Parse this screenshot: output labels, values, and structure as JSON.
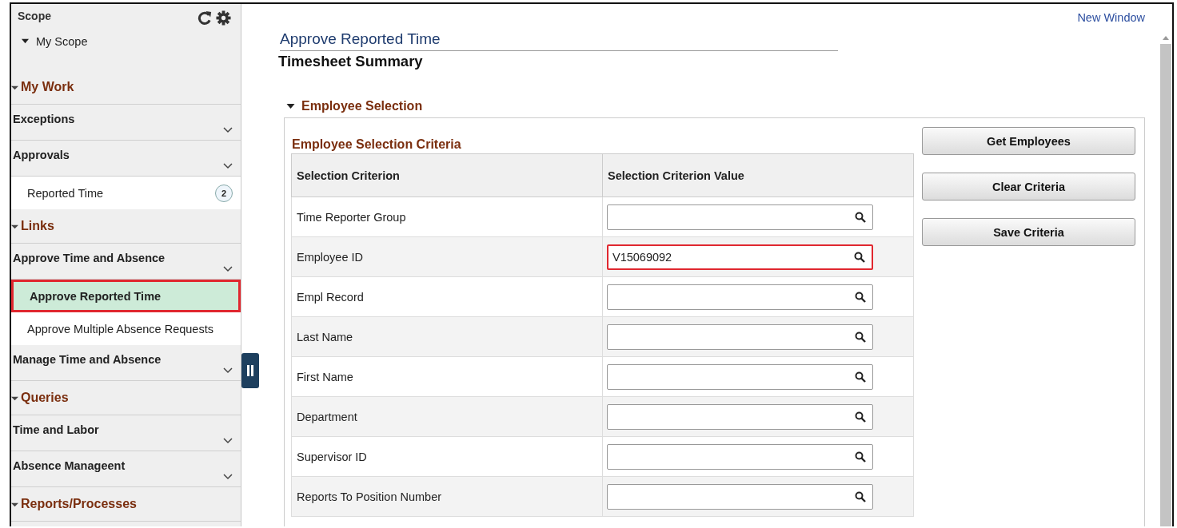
{
  "sidebar": {
    "scope": {
      "title": "Scope",
      "items": [
        {
          "label": "My Scope",
          "expanded": true
        }
      ]
    },
    "sections": [
      {
        "title": "My Work",
        "expanded": true,
        "groups": [
          {
            "label": "Exceptions"
          },
          {
            "label": "Approvals",
            "children": [
              {
                "label": "Reported Time",
                "badge": "2",
                "selected": false,
                "highlighted": false
              }
            ]
          }
        ]
      },
      {
        "title": "Links",
        "expanded": true,
        "groups": [
          {
            "label": "Approve Time and Absence",
            "children": [
              {
                "label": "Approve Reported Time",
                "selected": true,
                "highlighted": true
              },
              {
                "label": "Approve Multiple Absence Requests",
                "selected": false,
                "highlighted": false
              }
            ]
          },
          {
            "label": "Manage Time and Absence"
          }
        ]
      },
      {
        "title": "Queries",
        "expanded": true,
        "groups": [
          {
            "label": "Time and Labor"
          },
          {
            "label": "Absence Manageent"
          }
        ]
      },
      {
        "title": "Reports/Processes",
        "expanded": true
      }
    ]
  },
  "new_window_link": "New Window",
  "page_title": "Approve Reported Time",
  "page_subtitle": "Timesheet Summary",
  "section": {
    "title": "Employee Selection",
    "expanded": true,
    "criteria_title": "Employee Selection Criteria",
    "columns": [
      "Selection Criterion",
      "Selection Criterion Value"
    ],
    "rows": [
      {
        "label": "Time Reporter Group",
        "value": "",
        "highlighted": false
      },
      {
        "label": "Employee ID",
        "value": "V15069092",
        "highlighted": true
      },
      {
        "label": "Empl Record",
        "value": "",
        "highlighted": false
      },
      {
        "label": "Last Name",
        "value": "",
        "highlighted": false
      },
      {
        "label": "First Name",
        "value": "",
        "highlighted": false
      },
      {
        "label": "Department",
        "value": "",
        "highlighted": false
      },
      {
        "label": "Supervisor ID",
        "value": "",
        "highlighted": false
      },
      {
        "label": "Reports To Position Number",
        "value": "",
        "highlighted": false
      }
    ],
    "buttons": [
      "Get Employees",
      "Clear Criteria",
      "Save Criteria"
    ]
  }
}
